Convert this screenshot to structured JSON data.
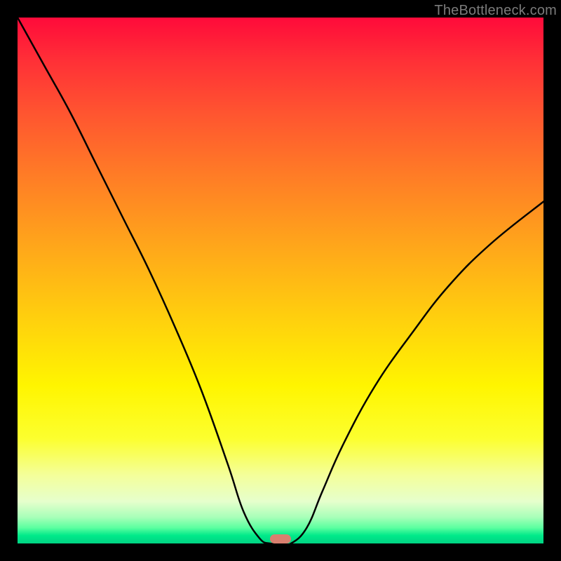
{
  "watermark": "TheBottleneck.com",
  "chart_data": {
    "type": "line",
    "title": "",
    "xlabel": "",
    "ylabel": "",
    "xlim": [
      0,
      100
    ],
    "ylim": [
      0,
      100
    ],
    "gradient_stops": [
      {
        "pos": 0,
        "color": "#ff0a3a"
      },
      {
        "pos": 8,
        "color": "#ff2f37"
      },
      {
        "pos": 18,
        "color": "#ff5430"
      },
      {
        "pos": 30,
        "color": "#ff7c26"
      },
      {
        "pos": 44,
        "color": "#ffa81a"
      },
      {
        "pos": 58,
        "color": "#ffd20d"
      },
      {
        "pos": 70,
        "color": "#fff500"
      },
      {
        "pos": 80,
        "color": "#fcff2e"
      },
      {
        "pos": 87,
        "color": "#f4ff9a"
      },
      {
        "pos": 92,
        "color": "#e6ffcc"
      },
      {
        "pos": 95,
        "color": "#a8ffb9"
      },
      {
        "pos": 97,
        "color": "#5cffa0"
      },
      {
        "pos": 98.5,
        "color": "#00e98a"
      },
      {
        "pos": 100,
        "color": "#00d383"
      }
    ],
    "series": [
      {
        "name": "bottleneck-curve",
        "x": [
          0,
          5,
          10,
          15,
          20,
          25,
          30,
          35,
          40,
          43,
          46,
          48,
          50,
          52,
          55,
          58,
          62,
          68,
          75,
          82,
          90,
          100
        ],
        "values": [
          100,
          91,
          82,
          72,
          62,
          52,
          41,
          29,
          15,
          6,
          1,
          0,
          0,
          0,
          3,
          10,
          19,
          30,
          40,
          49,
          57,
          65
        ]
      }
    ],
    "notch": {
      "x": 50,
      "color": "#d97f6f"
    }
  }
}
